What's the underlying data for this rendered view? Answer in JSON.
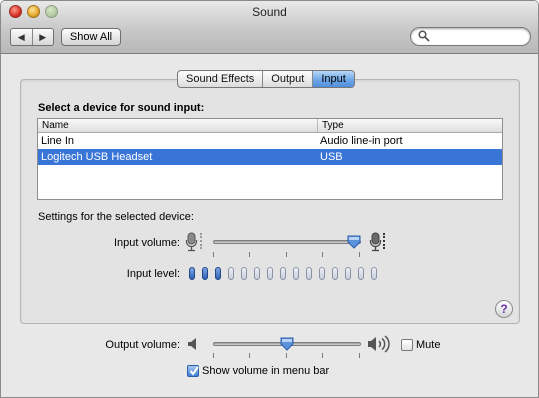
{
  "window": {
    "title": "Sound"
  },
  "toolbar": {
    "back_icon": "◀",
    "forward_icon": "▶",
    "show_all": "Show All",
    "search_placeholder": ""
  },
  "tabs": [
    {
      "label": "Sound Effects",
      "active": false
    },
    {
      "label": "Output",
      "active": false
    },
    {
      "label": "Input",
      "active": true
    }
  ],
  "input": {
    "heading": "Select a device for sound input:",
    "table": {
      "columns": [
        "Name",
        "Type"
      ],
      "rows": [
        {
          "name": "Line In",
          "type": "Audio line-in port",
          "selected": false
        },
        {
          "name": "Logitech USB Headset",
          "type": "USB",
          "selected": true
        }
      ]
    },
    "settings_label": "Settings for the selected device:",
    "input_volume_label": "Input volume:",
    "input_volume_value": 0.95,
    "input_level_label": "Input level:",
    "input_level_segments": 15,
    "input_level_active": 3
  },
  "output": {
    "label": "Output volume:",
    "volume_value": 0.5,
    "mute_label": "Mute",
    "mute_checked": false,
    "show_volume_label": "Show volume in menu bar",
    "show_volume_checked": true
  },
  "help": {
    "label": "?"
  },
  "colors": {
    "selection": "#3875d7",
    "active_tab": "#6fa7e6",
    "level_on": "#2d5fb1"
  }
}
